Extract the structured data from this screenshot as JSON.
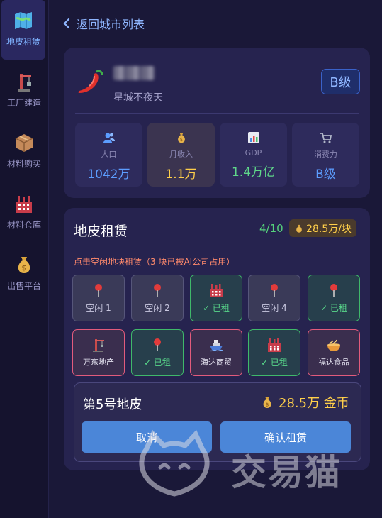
{
  "sidebar": {
    "items": [
      {
        "label": "地皮租赁",
        "icon": "map-icon"
      },
      {
        "label": "工厂建造",
        "icon": "crane-icon"
      },
      {
        "label": "材料购买",
        "icon": "box-icon"
      },
      {
        "label": "材料仓库",
        "icon": "warehouse-icon"
      },
      {
        "label": "出售平台",
        "icon": "money-bag-icon"
      }
    ]
  },
  "header": {
    "back_label": "返回城市列表"
  },
  "city": {
    "subtitle": "星城不夜天",
    "level_badge": "B级",
    "stats": [
      {
        "label": "人口",
        "value": "1042万",
        "icon": "people-icon",
        "color": "#5c9dff"
      },
      {
        "label": "月收入",
        "value": "1.1万",
        "icon": "money-bag-icon",
        "color": "#ffcf4a"
      },
      {
        "label": "GDP",
        "value": "1.4万亿",
        "icon": "bar-chart-icon",
        "color": "#5fd88a"
      },
      {
        "label": "消费力",
        "value": "B级",
        "icon": "cart-icon",
        "color": "#5c9dff"
      }
    ]
  },
  "land": {
    "title": "地皮租赁",
    "count": "4/10",
    "price_chip": "28.5万/块",
    "hint": "点击空闲地块租赁（3 块已被AI公司占用）",
    "plots": [
      {
        "state": "free",
        "label": "空闲 1",
        "icon": "pin-icon"
      },
      {
        "state": "free",
        "label": "空闲 2",
        "icon": "pin-icon"
      },
      {
        "state": "rented",
        "label": "✓ 已租",
        "icon": "factory-icon"
      },
      {
        "state": "free",
        "label": "空闲 4",
        "icon": "pin-icon"
      },
      {
        "state": "rented",
        "label": "✓ 已租",
        "icon": "pin-icon"
      },
      {
        "state": "ai",
        "label": "万东地产",
        "icon": "crane-icon"
      },
      {
        "state": "rented",
        "label": "✓ 已租",
        "icon": "pin-icon"
      },
      {
        "state": "ai",
        "label": "海达商贸",
        "icon": "ship-icon"
      },
      {
        "state": "rented",
        "label": "✓ 已租",
        "icon": "factory-icon"
      },
      {
        "state": "ai",
        "label": "福达食品",
        "icon": "noodle-bowl-icon"
      }
    ],
    "selected": {
      "title": "第5号地皮",
      "price": "28.5万 金币",
      "cancel_label": "取消",
      "confirm_label": "确认租赁"
    }
  },
  "watermark": {
    "text": "交易猫"
  }
}
